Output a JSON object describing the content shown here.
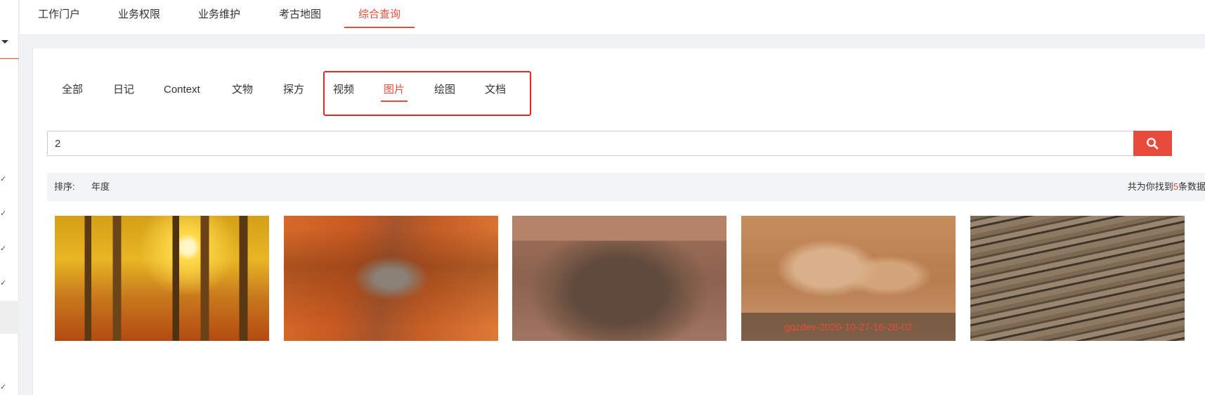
{
  "topnav": {
    "tabs": [
      {
        "label": "工作门户"
      },
      {
        "label": "业务权限"
      },
      {
        "label": "业务维护"
      },
      {
        "label": "考古地图"
      },
      {
        "label": "综合查询"
      }
    ],
    "active_index": 4
  },
  "categories": {
    "items": [
      {
        "label": "全部"
      },
      {
        "label": "日记"
      },
      {
        "label": "Context"
      },
      {
        "label": "文物"
      },
      {
        "label": "探方"
      },
      {
        "label": "视频"
      },
      {
        "label": "图片"
      },
      {
        "label": "绘图"
      },
      {
        "label": "文档"
      }
    ],
    "active_index": 6
  },
  "search": {
    "value": "2",
    "button_icon": "search-icon"
  },
  "sort": {
    "label": "排序:",
    "option": "年度"
  },
  "result_count": {
    "prefix": "共为你找到",
    "number": "5",
    "suffix": "条数据"
  },
  "gallery": {
    "items": [
      {
        "subject": "autumn forest path"
      },
      {
        "subject": "excavation trench"
      },
      {
        "subject": "tomb pit"
      },
      {
        "subject": "pottery jars",
        "caption": "gqzdev-2020-10-27-16-28-02"
      },
      {
        "subject": "rock strata"
      }
    ]
  },
  "colors": {
    "accent": "#e74c3c",
    "highlight_border": "#e8271f"
  }
}
